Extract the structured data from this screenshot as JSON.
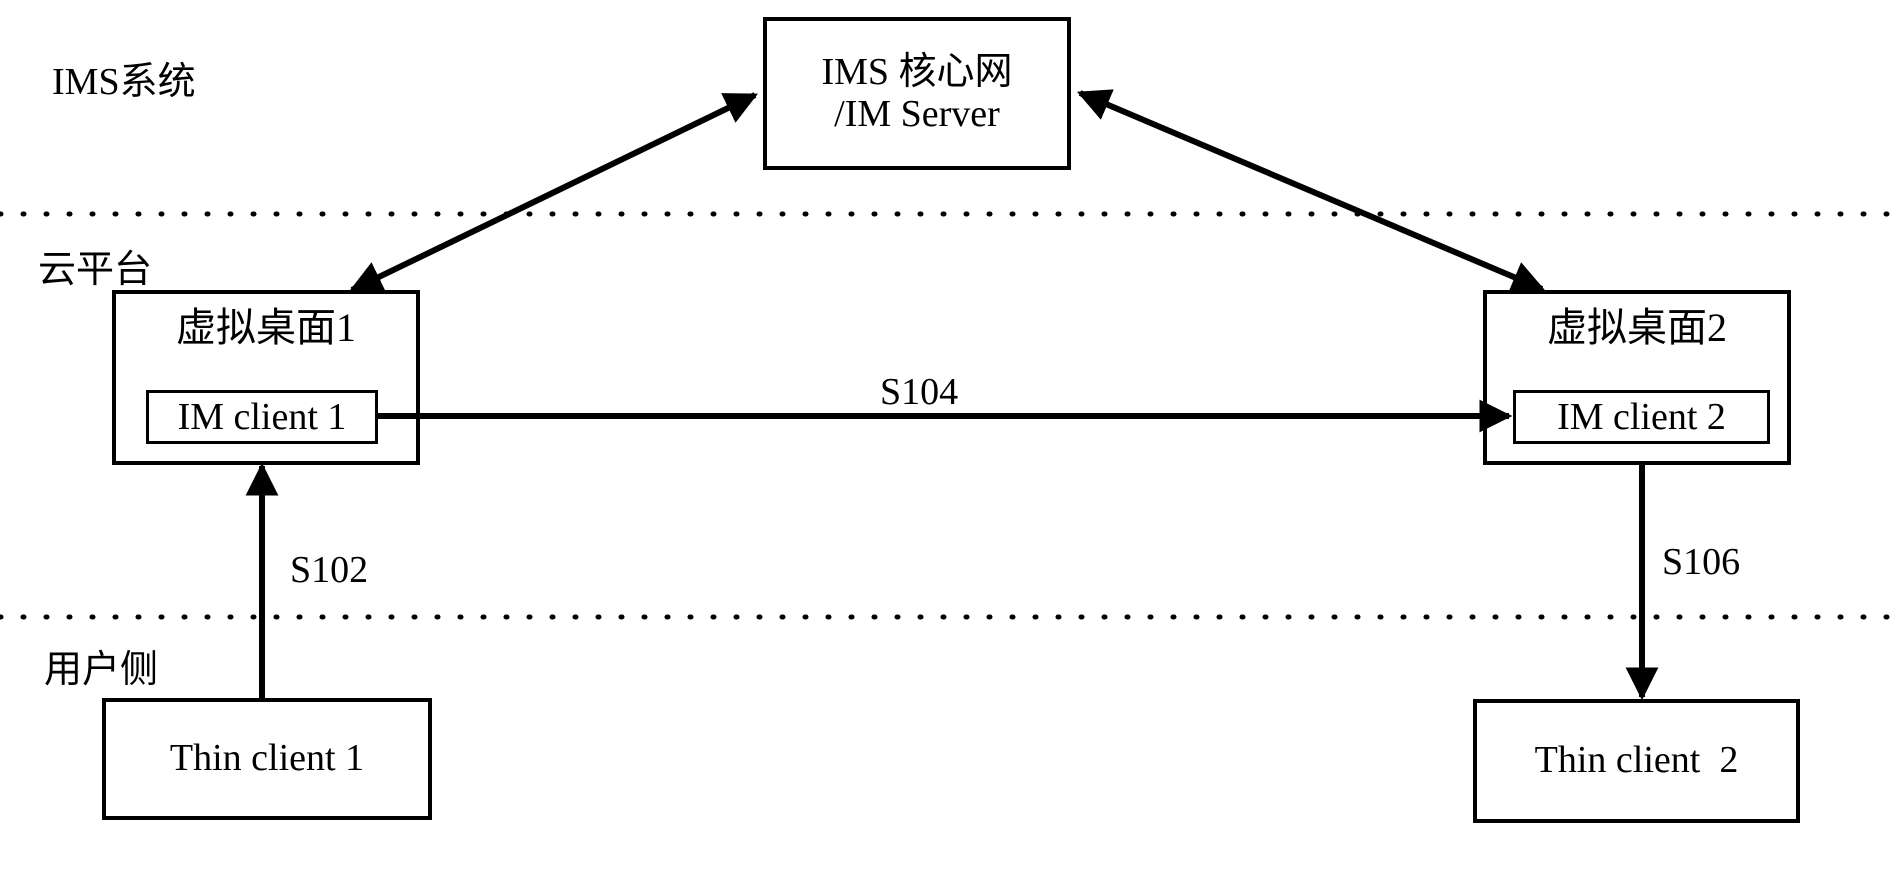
{
  "diagram": {
    "title": "IMS cloud virtual desktop instant messaging flow",
    "background_color": "#ffffff",
    "line_color": "#000000"
  },
  "zones": [
    {
      "id": "ims-system",
      "label": "IMS系统"
    },
    {
      "id": "cloud-platform",
      "label": "云平台"
    },
    {
      "id": "user-side",
      "label": "用户侧"
    }
  ],
  "nodes": {
    "ims_core": {
      "label": "IMS 核心网\n/IM Server"
    },
    "virtual_desktop_1": {
      "title": "虚拟桌面1",
      "client": "IM client 1"
    },
    "virtual_desktop_2": {
      "title": "虚拟桌面2",
      "client": "IM client 2"
    },
    "thin_client_1": {
      "label": "Thin client 1"
    },
    "thin_client_2": {
      "label": "Thin client  2"
    }
  },
  "edges": [
    {
      "id": "s102",
      "label": "S102",
      "from": "Thin client 1",
      "to": "虚拟桌面1"
    },
    {
      "id": "s104",
      "label": "S104",
      "from": "IM client 1",
      "to": "IM client 2"
    },
    {
      "id": "s106",
      "label": "S106",
      "from": "虚拟桌面2",
      "to": "Thin client  2"
    },
    {
      "id": "vd1-ims",
      "label": "",
      "from": "虚拟桌面1",
      "to": "IMS 核心网/IM Server"
    },
    {
      "id": "vd2-ims",
      "label": "",
      "from": "IMS 核心网/IM Server",
      "to": "虚拟桌面2"
    }
  ],
  "separators": [
    {
      "id": "divider-ims-cloud",
      "style": "dotted"
    },
    {
      "id": "divider-cloud-user",
      "style": "dotted"
    }
  ]
}
